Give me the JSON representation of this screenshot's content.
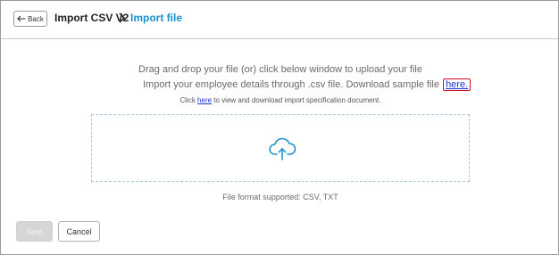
{
  "header": {
    "back_label": "Back",
    "breadcrumb_root": "Import CSV V2",
    "breadcrumb_current": "Import file"
  },
  "main": {
    "instruction_line1": "Drag and drop your file (or) click below window to upload your file",
    "instruction_line2_prefix": "Import your employee details through .csv file. Download sample file ",
    "sample_link": "here.",
    "spec_prefix": "Click ",
    "spec_link": "here",
    "spec_suffix": " to view and download import specification document.",
    "file_formats": "File format supported: CSV, TXT"
  },
  "footer": {
    "next_label": "Next",
    "cancel_label": "Cancel"
  },
  "colors": {
    "accent": "#1a90d0",
    "link": "#1a35d6",
    "highlight_border": "#d0102a",
    "dropzone_border": "#a9c8e0"
  },
  "icons": [
    "back-arrow-icon",
    "chevron-right-icon",
    "cloud-upload-icon"
  ]
}
